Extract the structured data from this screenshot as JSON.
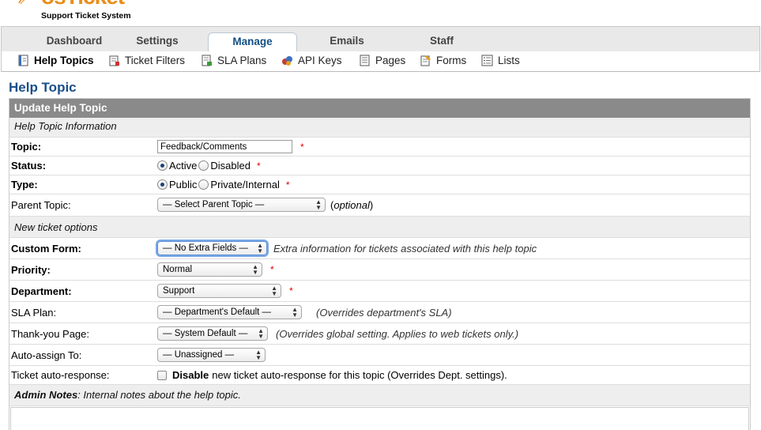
{
  "brand": {
    "word": "osTicket",
    "tagline": "Support Ticket System"
  },
  "nav": {
    "tabs": [
      {
        "label": "Dashboard",
        "active": false
      },
      {
        "label": "Settings",
        "active": false
      },
      {
        "label": "Manage",
        "active": true
      },
      {
        "label": "Emails",
        "active": false
      },
      {
        "label": "Staff",
        "active": false
      }
    ],
    "subtabs": [
      {
        "label": "Help Topics",
        "icon": "help-topics-icon",
        "active": true
      },
      {
        "label": "Ticket Filters",
        "icon": "ticket-filters-icon",
        "active": false
      },
      {
        "label": "SLA Plans",
        "icon": "sla-plans-icon",
        "active": false
      },
      {
        "label": "API Keys",
        "icon": "api-keys-icon",
        "active": false
      },
      {
        "label": "Pages",
        "icon": "pages-icon",
        "active": false
      },
      {
        "label": "Forms",
        "icon": "forms-icon",
        "active": false
      },
      {
        "label": "Lists",
        "icon": "lists-icon",
        "active": false
      }
    ]
  },
  "page": {
    "title": "Help Topic"
  },
  "form": {
    "header": "Update Help Topic",
    "section_info": "Help Topic Information",
    "topic": {
      "label": "Topic:",
      "value": "Feedback/Comments",
      "required": "*"
    },
    "status": {
      "label": "Status:",
      "options": [
        "Active",
        "Disabled"
      ],
      "selected": "Active",
      "required": "*"
    },
    "type": {
      "label": "Type:",
      "options": [
        "Public",
        "Private/Internal"
      ],
      "selected": "Public",
      "required": "*"
    },
    "parent_topic": {
      "label": "Parent Topic:",
      "value": "— Select Parent Topic —",
      "hint_open": "(",
      "hint_italic": "optional",
      "hint_close": ")"
    },
    "section_new": "New ticket options",
    "custom_form": {
      "label": "Custom Form:",
      "value": "— No Extra Fields —",
      "hint": "Extra information for tickets associated with this help topic"
    },
    "priority": {
      "label": "Priority:",
      "value": "Normal",
      "required": "*"
    },
    "department": {
      "label": "Department:",
      "value": "Support",
      "required": "*"
    },
    "sla_plan": {
      "label": "SLA Plan:",
      "value": "— Department's Default —",
      "hint": "(Overrides department's SLA)"
    },
    "thankyou": {
      "label": "Thank-you Page:",
      "value": "— System Default —",
      "hint": "(Overrides global setting. Applies to web tickets only.)"
    },
    "auto_assign": {
      "label": "Auto-assign To:",
      "value": "— Unassigned —"
    },
    "auto_response": {
      "label": "Ticket auto-response:",
      "checked": false,
      "bold": "Disable",
      "text": "new ticket auto-response for this topic (Overrides Dept. settings)."
    },
    "admin_notes": {
      "bold": "Admin Notes",
      "text": ": Internal notes about the help topic."
    }
  },
  "colors": {
    "brand": "#e98d1a",
    "title": "#194f8a",
    "header_bar": "#8a8a8a",
    "required": "#dd0000"
  }
}
